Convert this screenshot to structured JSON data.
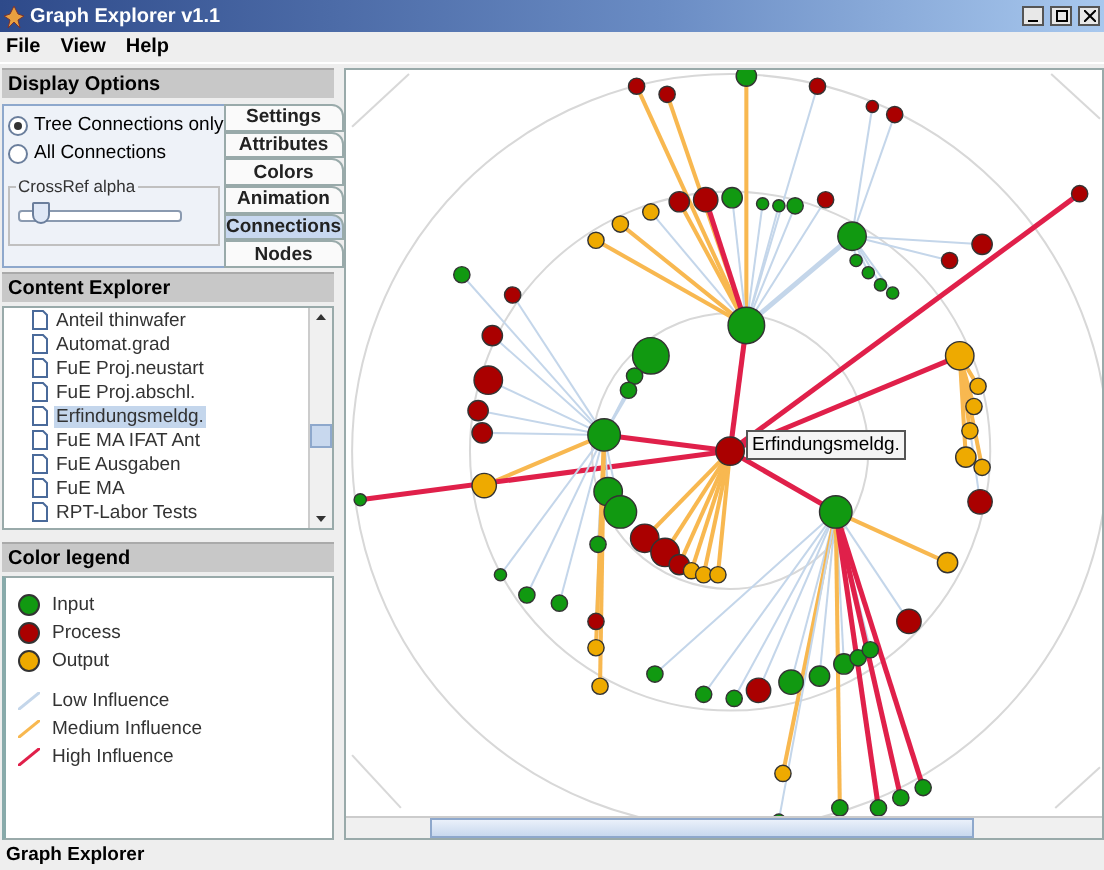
{
  "window": {
    "title": "Graph Explorer v1.1"
  },
  "menu": [
    "File",
    "View",
    "Help"
  ],
  "display_options": {
    "title": "Display Options",
    "radios": [
      {
        "label": "Tree Connections only",
        "selected": true
      },
      {
        "label": "All Connections",
        "selected": false
      }
    ],
    "slider": {
      "label": "CrossRef alpha",
      "level": 0.12
    },
    "tabs": [
      {
        "label": "Settings",
        "selected": false
      },
      {
        "label": "Attributes",
        "selected": false
      },
      {
        "label": "Colors",
        "selected": false
      },
      {
        "label": "Animation",
        "selected": false
      },
      {
        "label": "Connections",
        "selected": true
      },
      {
        "label": "Nodes",
        "selected": false
      }
    ]
  },
  "content_explorer": {
    "title": "Content Explorer",
    "items": [
      {
        "label": "Anteil thinwafer",
        "selected": false
      },
      {
        "label": "Automat.grad",
        "selected": false
      },
      {
        "label": "FuE Proj.neustart",
        "selected": false
      },
      {
        "label": "FuE Proj.abschl.",
        "selected": false
      },
      {
        "label": "Erfindungsmeldg.",
        "selected": true
      },
      {
        "label": "FuE MA IFAT Ant",
        "selected": false
      },
      {
        "label": "FuE Ausgaben",
        "selected": false
      },
      {
        "label": "FuE MA",
        "selected": false
      },
      {
        "label": "RPT-Labor Tests",
        "selected": false
      }
    ]
  },
  "color_legend": {
    "title": "Color legend",
    "items": [
      {
        "kind": "node",
        "label": "Input",
        "color": "#119911"
      },
      {
        "kind": "node",
        "label": "Process",
        "color": "#aa0000"
      },
      {
        "kind": "node",
        "label": "Output",
        "color": "#eeaa00"
      },
      {
        "kind": "line",
        "label": "Low Influence",
        "color": "#c4d6ea"
      },
      {
        "kind": "line",
        "label": "Medium Influence",
        "color": "#f8b850"
      },
      {
        "kind": "line",
        "label": "High Influence",
        "color": "#e0204a"
      }
    ]
  },
  "graph": {
    "tooltip": "Erfindungsmeldg."
  },
  "status_bar": "Graph Explorer"
}
